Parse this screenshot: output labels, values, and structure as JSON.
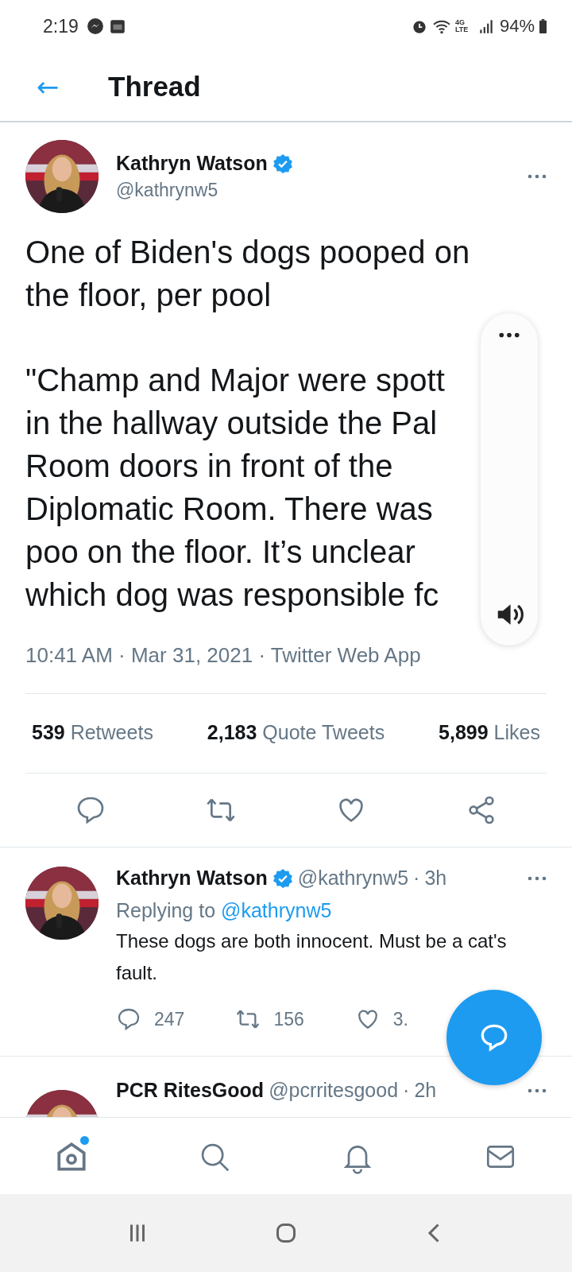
{
  "status_bar": {
    "time": "2:19",
    "network": "4G LTE",
    "battery": "94%"
  },
  "header": {
    "back": "←",
    "title": "Thread"
  },
  "tweet": {
    "name": "Kathryn Watson",
    "verified": true,
    "handle": "@kathrynw5",
    "paragraphs": [
      [
        "One of Biden's dogs pooped on",
        "the floor, per pool"
      ],
      [
        "\"Champ and Major were spott",
        "in the hallway outside the Pal",
        "Room doors in front of the",
        "Diplomatic Room. There was",
        "poo on the floor. It’s unclear",
        "which dog was responsible fc"
      ]
    ],
    "timestamp": "10:41 AM · Mar 31, 2021 · Twitter Web App",
    "stats": [
      {
        "count": "539",
        "label": "Retweets"
      },
      {
        "count": "2,183",
        "label": "Quote Tweets"
      },
      {
        "count": "5,899",
        "label": "Likes"
      }
    ]
  },
  "replies": [
    {
      "name": "Kathryn Watson",
      "verified": true,
      "handle": "@kathrynw5",
      "separator": "·",
      "time": "3h",
      "replying_prefix": "Replying to",
      "replying_to": "@kathrynw5",
      "text": "These dogs are both innocent. Must be a cat's fault.",
      "replies": "247",
      "retweets": "156",
      "likes": "3."
    },
    {
      "name": "PCR RitesGood",
      "verified": false,
      "handle": "@pcrritesgood",
      "separator": "·",
      "time": "2h"
    }
  ],
  "bottom_nav": [
    {
      "kind": "home",
      "selected": true,
      "badge": true
    },
    {
      "kind": "search",
      "selected": false,
      "badge": false
    },
    {
      "kind": "notifications",
      "selected": false,
      "badge": false
    },
    {
      "kind": "messages",
      "selected": false,
      "badge": false
    }
  ]
}
